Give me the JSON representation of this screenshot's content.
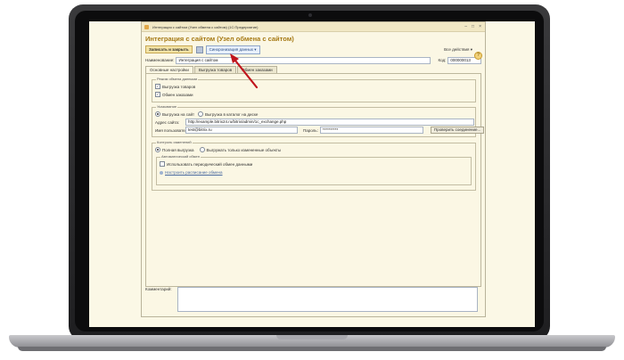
{
  "window": {
    "title": "Интеграция с сайтом (Узел обмена с сайтом) (1С:Предприятие)",
    "heading": "Интеграция с сайтом (Узел обмена с сайтом)"
  },
  "toolbar": {
    "save_close_label": "Записать и закрыть",
    "sync_label": "Синхронизация данных",
    "all_actions_label": "Все действия",
    "help_label": "?"
  },
  "fields": {
    "name_label": "Наименование:",
    "name_value": "Интеграция с сайтом",
    "code_label": "Код:",
    "code_value": "000000013"
  },
  "tabs": [
    "Основные настройки",
    "Выгрузка товаров",
    "Обмен заказами"
  ],
  "exchange_mode": {
    "title": "Режим обмена данными",
    "export_goods": "Выгрузка товаров",
    "exchange_orders": "Обмен заказами"
  },
  "uploading": {
    "title": "Указывание",
    "upload_to_site": "Выгрузка на сайт",
    "upload_to_disk": "Выгрузка в каталог на диске",
    "site_address_label": "Адрес сайта:",
    "site_address_value": "http://example.bitrix24.ru/bitrix/admin/1c_exchange.php",
    "user_label": "Имя пользователя:",
    "user_value": "test@bitrix.ru",
    "password_label": "Пароль:",
    "password_value": "**********",
    "test_button": "Проверить соединение..."
  },
  "change_control": {
    "title": "Контроль изменений",
    "full_export": "Полная выгрузка",
    "changed_only": "Выгружать только измененные объекты"
  },
  "auto_exchange": {
    "title": "Автоматический обмен",
    "periodic": "Использовать периодический обмен данными",
    "schedule_link": "Настроить расписание обмена"
  },
  "comment": {
    "label": "Комментарий:"
  }
}
